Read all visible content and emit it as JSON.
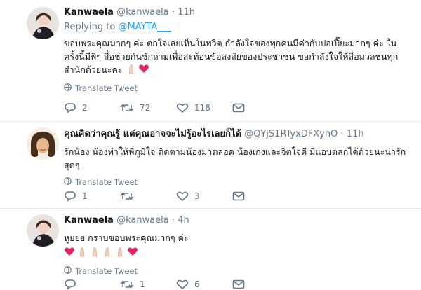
{
  "tweets": [
    {
      "name": "Kanwaela",
      "handle": "@kanwaela",
      "dot": "·",
      "time": "11h",
      "replying_prefix": "Replying to ",
      "replying_mention": "@MAYTA___",
      "text": "ขอบพระคุณมากๆ ค่ะ ตกใจเลยเห็นในทวิต กำลังใจของทุกคนมีค่ากับปอเปี๊ยะมากๆ ค่ะ ในครั้งนี้มีพี่ๆ สื่อช่วยกันซักถามเพื่อสะท้อนข้อสงสัยของประชาชน ขอกำลังใจให้สื่อมวลชนทุกสำนักด้วยนะคะ",
      "emoji": [
        "praying-hands-icon",
        "red-heart-icon"
      ],
      "translate": "Translate Tweet",
      "replies": "2",
      "retweets": "72",
      "likes": "118"
    },
    {
      "name": "คุณคิดว่าคุณรู้ แต่คุณอาจจะไม่รู้อะไรเลยก็ได้",
      "handle": "@QYjS1RTyxDFXyhO",
      "dot": "·",
      "time": "11h",
      "text": "รักน้อง น้องทำให้พี่ภูมิใจ ติดตามน้องมาตลอด น้องเก่งและจิตใจดี มีแอบตลกได้ด้วยนะน่ารักสุดๆ",
      "translate": "Translate Tweet",
      "replies": "1",
      "retweets": "",
      "likes": "3"
    },
    {
      "name": "Kanwaela",
      "handle": "@kanwaela",
      "dot": "·",
      "time": "4h",
      "text": "หูยยย กราบขอบพระคุณมากๆ ค่ะ",
      "emoji": [
        "red-heart-icon",
        "praying-hands-icon",
        "praying-hands-icon",
        "praying-hands-icon",
        "praying-hands-icon",
        "red-heart-icon"
      ],
      "translate": "Translate Tweet",
      "replies": "",
      "retweets": "1",
      "likes": "6"
    }
  ],
  "colors": {
    "link": "#1da1f2",
    "muted": "#657786",
    "heart": "#e0245e"
  }
}
